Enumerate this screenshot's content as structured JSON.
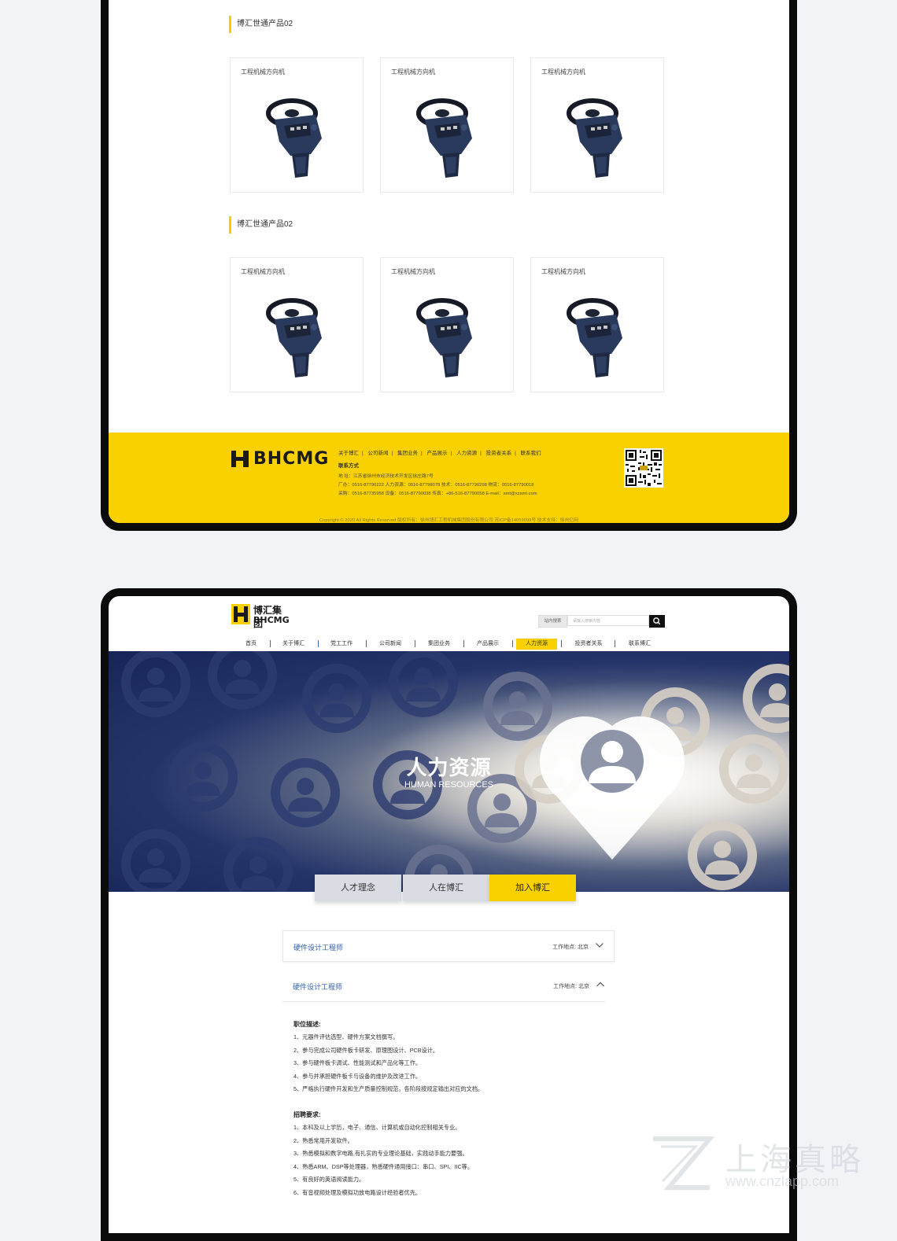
{
  "products": {
    "sections": [
      {
        "title": "博汇世通产品02",
        "items": [
          "工程机械方向机",
          "工程机械方向机",
          "工程机械方向机"
        ]
      },
      {
        "title": "博汇世通产品02",
        "items": [
          "工程机械方向机",
          "工程机械方向机",
          "工程机械方向机"
        ]
      }
    ]
  },
  "footer": {
    "logo_text": "BHCMG",
    "nav": [
      "关于博汇",
      "公司新闻",
      "集团业务",
      "产品展示",
      "人力资源",
      "投资者关系",
      "联系我们"
    ],
    "contact_title": "联系方式",
    "address": "地 址：江苏省徐州市经济技术开发区徐庄路7号",
    "phones_1": "厂办：0516-87790222   人力资源：0516-87798078   技术：0516-87790298   物流：0516-87790018",
    "phones_2": "采购：0516-87735958   设备：0516-87790038   传真：+86-516-87790058   E-mail：smt@xzsmt.com",
    "copyright": "Copyright © 2020 All Rights Reserved 版权所有：徐州博汇工程机械集团股份有限公司 苏ICP备14059099号 技术支持：徐州亿网"
  },
  "header": {
    "logo_cn": "博汇集团",
    "logo_en": "BHCMG",
    "search_label": "站内搜索",
    "search_placeholder": "请输入搜索内容",
    "nav": [
      {
        "label": "首页",
        "active": false
      },
      {
        "label": "关于博汇",
        "active": false
      },
      {
        "label": "党工工作",
        "active": false
      },
      {
        "label": "公司新闻",
        "active": false
      },
      {
        "label": "集团业务",
        "active": false
      },
      {
        "label": "产品展示",
        "active": false
      },
      {
        "label": "人力资源",
        "active": true
      },
      {
        "label": "投资者关系",
        "active": false
      },
      {
        "label": "联系博汇",
        "active": false
      }
    ]
  },
  "banner": {
    "title": "人力资源",
    "subtitle": "HUMAN RESOURCES"
  },
  "tabs": [
    {
      "label": "人才理念",
      "active": false
    },
    {
      "label": "人在博汇",
      "active": false
    },
    {
      "label": "加入博汇",
      "active": true
    }
  ],
  "jobs": [
    {
      "title": "硬件设计工程师",
      "location": "工作地点: 北京",
      "expanded": false
    },
    {
      "title": "硬件设计工程师",
      "location": "工作地点: 北京",
      "expanded": true
    }
  ],
  "job_detail": {
    "duty_title": "职位描述:",
    "duties": [
      "1、元器件评估选型、硬件方案文档撰写。",
      "2、参与完成公司硬件板卡研发、原理图设计、PCB设计。",
      "3、参与硬件板卡调试、性能测试和产品化等工作。",
      "4、参与并承担硬件板卡与设备的维护及改进工作。",
      "5、严格执行硬件开发和生产质量控制规范，各阶段按规定输出对应的文档。"
    ],
    "req_title": "招聘要求:",
    "requirements": [
      "1、本科及以上学历，电子、通信、计算机或自动化控制相关专业。",
      "2、熟悉常用开发软件。",
      "3、熟悉模拟和数字电路,有扎实的专业理论基础，实践动手能力要强。",
      "4、熟悉ARM、DSP等处理器，熟悉硬件通用接口：串口、SPI、IIC等。",
      "5、有良好的英语阅读能力。",
      "6、有音视频处理及模拟功放电路设计经验者优先。"
    ]
  },
  "watermark": {
    "cn": "上海真略",
    "url": "www.cnzlapp.com"
  },
  "colors": {
    "accent_yellow": "#f9d100",
    "link_blue": "#2f5fa5",
    "frame": "#0b0b0b",
    "page_bg": "#f1f3f7"
  }
}
